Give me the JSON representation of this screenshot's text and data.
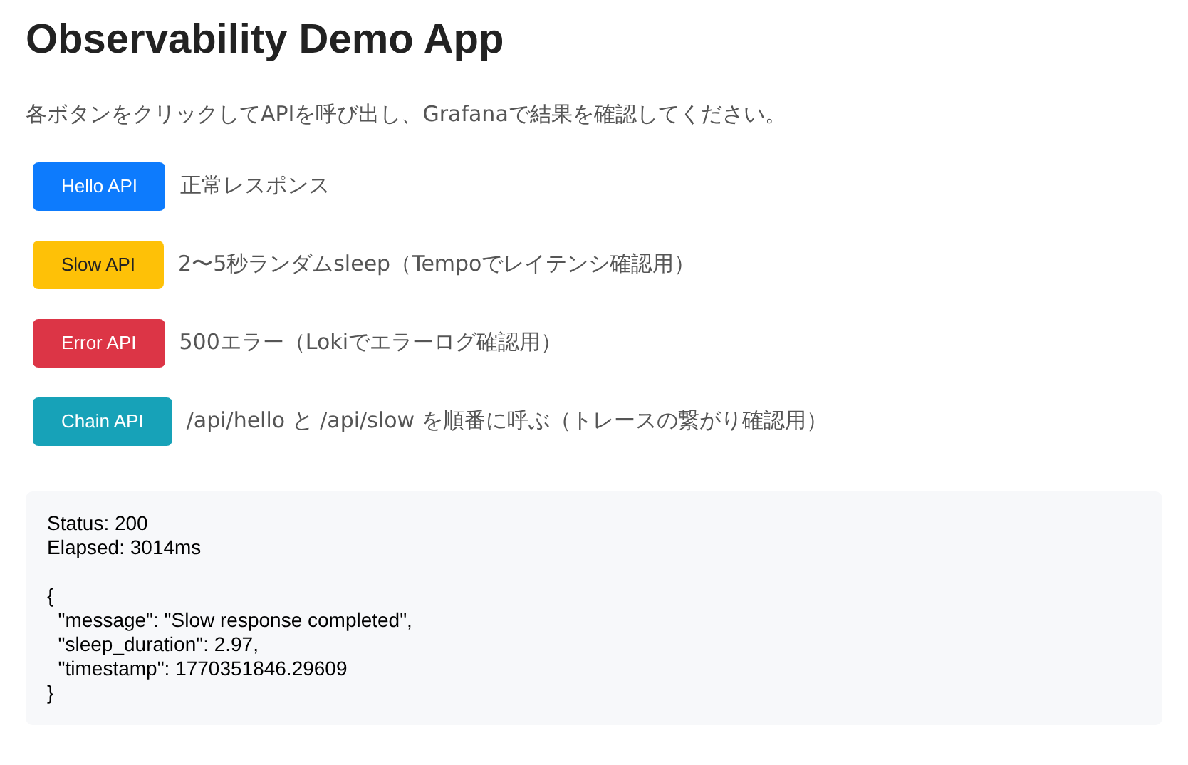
{
  "title": "Observability Demo App",
  "description": "各ボタンをクリックしてAPIを呼び出し、Grafanaで結果を確認してください。",
  "actions": [
    {
      "label": "Hello API",
      "kind": "primary",
      "note": "正常レスポンス"
    },
    {
      "label": "Slow API",
      "kind": "warning",
      "note": "2〜5秒ランダムsleep（Tempoでレイテンシ確認用）"
    },
    {
      "label": "Error API",
      "kind": "danger",
      "note": "500エラー（Lokiでエラーログ確認用）"
    },
    {
      "label": "Chain API",
      "kind": "info",
      "note": "/api/hello と /api/slow を順番に呼ぶ（トレースの繋がり確認用）"
    }
  ],
  "result": {
    "header_lines": [
      "Status: 200",
      "Elapsed: 3014ms"
    ],
    "body_lines": [
      "{",
      "  \"message\": \"Slow response completed\",",
      "  \"sleep_duration\": 2.97,",
      "  \"timestamp\": 1770351846.29609",
      "}"
    ]
  }
}
